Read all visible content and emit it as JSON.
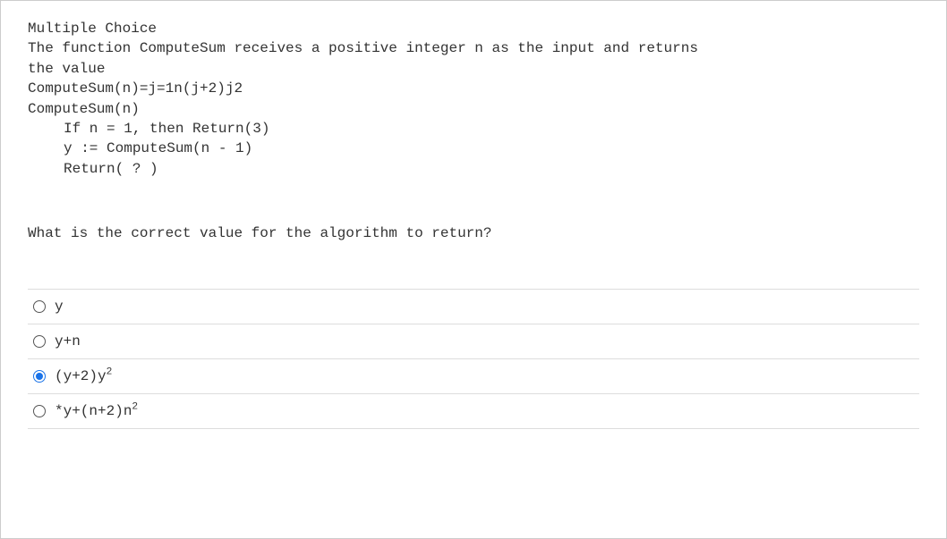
{
  "question": {
    "header": "Multiple Choice",
    "line1": "The  function ComputeSum receives a positive integer n as the input and returns",
    "line2": "the value",
    "line3": "ComputeSum(n)=j=1n(j+2)j2",
    "line4": "ComputeSum(n)",
    "line5": "If n = 1, then Return(3)",
    "line6": "y := ComputeSum(n - 1)",
    "line7": "Return( ? )",
    "prompt": "What is the correct value for the algorithm to return?"
  },
  "options": [
    {
      "label_html": "y",
      "selected": false
    },
    {
      "label_html": "y+n",
      "selected": false
    },
    {
      "label_html": "(y+2)y<sup>2</sup>",
      "selected": true
    },
    {
      "label_html": "*y+(n+2)n<sup>2</sup>",
      "selected": false
    }
  ]
}
